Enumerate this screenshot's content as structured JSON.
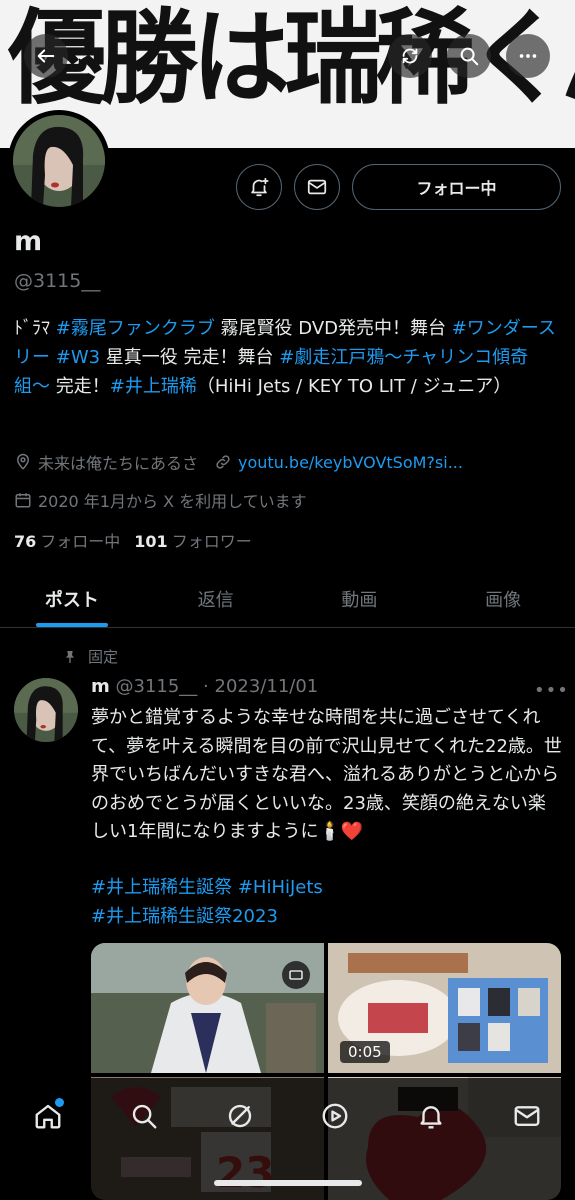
{
  "banner": {
    "text": "優勝は瑞稀くん!"
  },
  "profile": {
    "follow_label": "フォロー中",
    "name": "m",
    "handle": "@3115__",
    "bio": {
      "p1": "ﾄﾞﾗﾏ ",
      "tag1": "#霧尾ファンクラブ",
      "p2": " 霧尾賢役 DVD発売中！舞台 ",
      "tag2": "#ワンダースリー",
      "p3": " ",
      "tag3": "#W3",
      "p4": " 星真一役 完走！舞台 ",
      "tag4": "#劇走江戸鴉〜チャリンコ傾奇組〜",
      "p5": " 完走！",
      "tag5": "#井上瑞稀",
      "p6": "（HiHi Jets / KEY TO LIT / ジュニア）"
    },
    "location": "未来は俺たちにあるさ",
    "link": "youtu.be/keybVOVtSoM?si...",
    "joined": "2020 年1月から X を利用しています",
    "following_count": "76",
    "following_label": "フォロー中",
    "followers_count": "101",
    "followers_label": "フォロワー"
  },
  "tabs": [
    {
      "label": "ポスト",
      "active": true
    },
    {
      "label": "返信",
      "active": false
    },
    {
      "label": "動画",
      "active": false
    },
    {
      "label": "画像",
      "active": false
    }
  ],
  "post": {
    "pinned_label": "固定",
    "author_name": "m",
    "author_handle": "@3115__",
    "date": "2023/11/01",
    "text": "夢かと錯覚するような幸せな時間を共に過ごさせてくれて、夢を叶える瞬間を目の前で沢山見せてくれた22歳。世界でいちばんだいすきな君へ、溢れるありがとうと心からのおめでとうが届くといいな。23歳、笑顔の絶えない楽しい1年間になりますように🕯️❤️",
    "tag1": "#井上瑞稀生誕祭",
    "tag2": "#HiHiJets",
    "tag3": "#井上瑞稀生誕祭2023",
    "video_duration": "0:05"
  },
  "colors": {
    "accent": "#1d9bf0",
    "background": "#000000",
    "text": "#e7e9ea",
    "muted": "#71767b"
  },
  "icons": {
    "nav": [
      "back-arrow-icon",
      "repost-icon",
      "search-icon",
      "more-icon"
    ],
    "actions": [
      "notification-add-icon",
      "message-icon"
    ],
    "bottom": [
      "home-icon",
      "search-icon",
      "grok-icon",
      "video-icon",
      "notifications-icon",
      "messages-icon"
    ]
  }
}
